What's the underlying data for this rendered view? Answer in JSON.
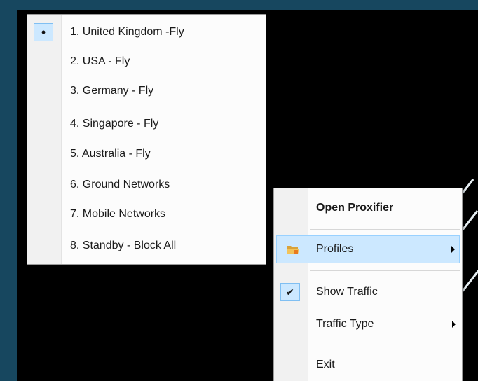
{
  "profiles_menu": {
    "items": [
      {
        "label": "1. United Kingdom -Fly"
      },
      {
        "label": "2. USA - Fly"
      },
      {
        "label": "3. Germany - Fly"
      },
      {
        "label": "4. Singapore - Fly"
      },
      {
        "label": "5. Australia - Fly"
      },
      {
        "label": "6. Ground Networks"
      },
      {
        "label": "7. Mobile Networks"
      },
      {
        "label": "8. Standby - Block All"
      }
    ],
    "selected_mark": "•"
  },
  "tray_menu": {
    "open_label": "Open Proxifier",
    "profiles_label": "Profiles",
    "show_traffic_label": "Show Traffic",
    "show_traffic_check": "✔",
    "traffic_type_label": "Traffic Type",
    "exit_label": "Exit",
    "profiles_icon": "folder-icon"
  },
  "colors": {
    "desktop": "#17475f",
    "highlight": "#cce8ff",
    "highlight_border": "#99d1ff"
  }
}
